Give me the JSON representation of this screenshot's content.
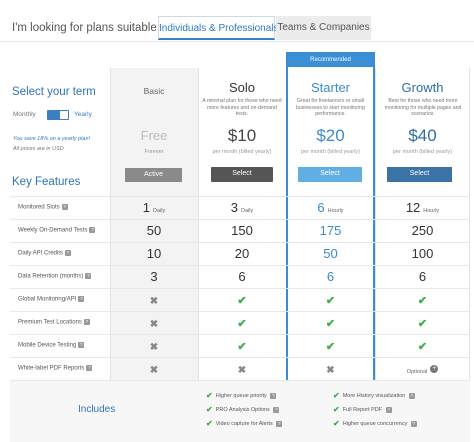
{
  "header": {
    "looking_label": "I'm looking for plans suitable for",
    "tabs": [
      "Individuals & Professionals",
      "Teams & Companies"
    ],
    "active_tab": "Individuals & Professionals"
  },
  "term": {
    "heading": "Select your term",
    "monthly_label": "Monthly",
    "yearly_label": "Yearly",
    "selected": "Yearly",
    "save_note": "You save 18% on a yearly plan!",
    "currency_note": "All prices are in USD"
  },
  "recommended_label": "Recommended",
  "plans": [
    {
      "name": "Basic",
      "description": "",
      "price": "Free",
      "period": "Forever",
      "button": "Active"
    },
    {
      "name": "Solo",
      "description": "A minimal plan for those who need more features and on-demand tests.",
      "price": "$10",
      "period": "per month (billed yearly)",
      "button": "Select"
    },
    {
      "name": "Starter",
      "description": "Great for freelancers or small businesses to start monitoring performance.",
      "price": "$20",
      "period": "per month (billed yearly)",
      "button": "Select"
    },
    {
      "name": "Growth",
      "description": "Best for those who need more monitoring for multiple pages and scenarios.",
      "price": "$40",
      "period": "per month (billed yearly)",
      "button": "Select"
    }
  ],
  "features_heading": "Key Features",
  "features": [
    {
      "label": "Monitored Slots",
      "help": "?",
      "values": [
        {
          "v": "1",
          "u": "Daily"
        },
        {
          "v": "3",
          "u": "Daily"
        },
        {
          "v": "6",
          "u": "Hourly"
        },
        {
          "v": "12",
          "u": "Hourly"
        }
      ]
    },
    {
      "label": "Weekly On-Demand Tests",
      "help": "?",
      "values": [
        {
          "v": "50",
          "u": ""
        },
        {
          "v": "150",
          "u": ""
        },
        {
          "v": "175",
          "u": ""
        },
        {
          "v": "250",
          "u": ""
        }
      ]
    },
    {
      "label": "Daily API Credits",
      "help": "?",
      "values": [
        {
          "v": "10",
          "u": ""
        },
        {
          "v": "20",
          "u": ""
        },
        {
          "v": "50",
          "u": ""
        },
        {
          "v": "100",
          "u": ""
        }
      ]
    },
    {
      "label": "Data Retention (months)",
      "help": "?",
      "values": [
        {
          "v": "3",
          "u": ""
        },
        {
          "v": "6",
          "u": ""
        },
        {
          "v": "6",
          "u": ""
        },
        {
          "v": "6",
          "u": ""
        }
      ]
    },
    {
      "label": "Global Monitoring/API",
      "help": "?",
      "values": [
        "cross",
        "check",
        "check",
        "check"
      ]
    },
    {
      "label": "Premium Test Locations",
      "help": "?",
      "values": [
        "cross",
        "check",
        "check",
        "check"
      ]
    },
    {
      "label": "Mobile Device Testing",
      "help": "?",
      "values": [
        "cross",
        "check",
        "check",
        "check"
      ]
    },
    {
      "label": "White-label PDF Reports",
      "help": "?",
      "values": [
        "cross",
        "cross",
        "cross",
        "optional"
      ]
    }
  ],
  "optional_label": "Optional",
  "includes": {
    "heading": "Includes",
    "starter_items": [
      "Higher queue priority",
      "PRO Analysis Options",
      "Video capture for Alerts"
    ],
    "growth_items": [
      "More History visualization",
      "Full Report PDF",
      "Higher queue concurrency"
    ]
  },
  "colors": {
    "accent": "#3a8bd0",
    "check": "#3cae4a",
    "growth": "#2e6da4"
  }
}
